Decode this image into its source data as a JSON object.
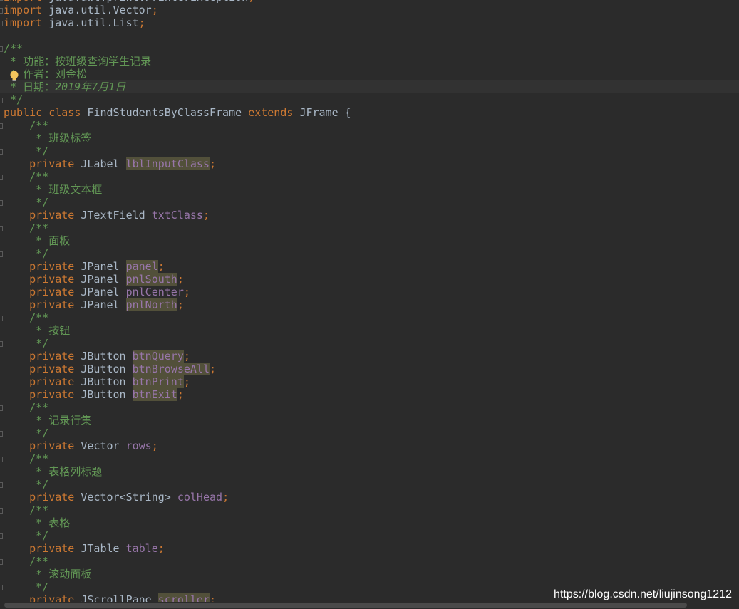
{
  "lines": [
    {
      "kind": "import",
      "kw": "import",
      "text": " java.awt.print.PrinterException",
      "end": ";"
    },
    {
      "kind": "import",
      "kw": "import",
      "text": " java.util.Vector",
      "end": ";"
    },
    {
      "kind": "import",
      "kw": "import",
      "text": " java.util.List",
      "end": ";"
    },
    {
      "kind": "blank"
    },
    {
      "kind": "comment",
      "text": "/**"
    },
    {
      "kind": "comment",
      "text": " * 功能：按班级查询学生记录"
    },
    {
      "kind": "comment",
      "text": " * 作者：刘金松"
    },
    {
      "kind": "datecomment",
      "prefix": " * 日期：",
      "date": "2019年7月1日"
    },
    {
      "kind": "comment",
      "text": " */"
    },
    {
      "kind": "classdecl",
      "kw1": "public",
      "kw2": "class",
      "name": "FindStudentsByClassFrame",
      "kw3": "extends",
      "parent": "JFrame {"
    },
    {
      "kind": "comment",
      "text": "    /**"
    },
    {
      "kind": "comment",
      "text": "     * 班级标签"
    },
    {
      "kind": "comment",
      "text": "     */"
    },
    {
      "kind": "field",
      "type": "JLabel",
      "name": "lblInputClass",
      "used": true
    },
    {
      "kind": "comment",
      "text": "    /**"
    },
    {
      "kind": "comment",
      "text": "     * 班级文本框"
    },
    {
      "kind": "comment",
      "text": "     */"
    },
    {
      "kind": "field",
      "type": "JTextField",
      "name": "txtClass",
      "used": false
    },
    {
      "kind": "comment",
      "text": "    /**"
    },
    {
      "kind": "comment",
      "text": "     * 面板"
    },
    {
      "kind": "comment",
      "text": "     */"
    },
    {
      "kind": "field",
      "type": "JPanel",
      "name": "panel",
      "used": true
    },
    {
      "kind": "field",
      "type": "JPanel",
      "name": "pnlSouth",
      "used": true
    },
    {
      "kind": "field",
      "type": "JPanel",
      "name": "pnlCenter",
      "used": false
    },
    {
      "kind": "field",
      "type": "JPanel",
      "name": "pnlNorth",
      "used": true
    },
    {
      "kind": "comment",
      "text": "    /**"
    },
    {
      "kind": "comment",
      "text": "     * 按钮"
    },
    {
      "kind": "comment",
      "text": "     */"
    },
    {
      "kind": "field",
      "type": "JButton",
      "name": "btnQuery",
      "used": true
    },
    {
      "kind": "field",
      "type": "JButton",
      "name": "btnBrowseAll",
      "used": true
    },
    {
      "kind": "field",
      "type": "JButton",
      "name": "btnPrint",
      "used": true
    },
    {
      "kind": "field",
      "type": "JButton",
      "name": "btnExit",
      "used": true
    },
    {
      "kind": "comment",
      "text": "    /**"
    },
    {
      "kind": "comment",
      "text": "     * 记录行集"
    },
    {
      "kind": "comment",
      "text": "     */"
    },
    {
      "kind": "field",
      "type": "Vector",
      "name": "rows",
      "used": false
    },
    {
      "kind": "comment",
      "text": "    /**"
    },
    {
      "kind": "comment",
      "text": "     * 表格列标题"
    },
    {
      "kind": "comment",
      "text": "     */"
    },
    {
      "kind": "field",
      "type": "Vector<String>",
      "name": "colHead",
      "used": false
    },
    {
      "kind": "comment",
      "text": "    /**"
    },
    {
      "kind": "comment",
      "text": "     * 表格"
    },
    {
      "kind": "comment",
      "text": "     */"
    },
    {
      "kind": "field",
      "type": "JTable",
      "name": "table",
      "used": false
    },
    {
      "kind": "comment",
      "text": "    /**"
    },
    {
      "kind": "comment",
      "text": "     * 滚动面板"
    },
    {
      "kind": "comment",
      "text": "     */"
    },
    {
      "kind": "field",
      "type": "JScrollPane",
      "name": "scroller",
      "used": true
    }
  ],
  "field_keyword": "private",
  "semicolon": ";",
  "highlighted_line": 7,
  "watermark": "https://blog.csdn.net/liujinsong1212",
  "icons": {
    "bulb": "lightbulb-icon"
  },
  "colors": {
    "background": "#2b2b2b",
    "keyword": "#cc7832",
    "comment": "#629755",
    "field": "#9876aa",
    "text": "#a9b7c6"
  }
}
